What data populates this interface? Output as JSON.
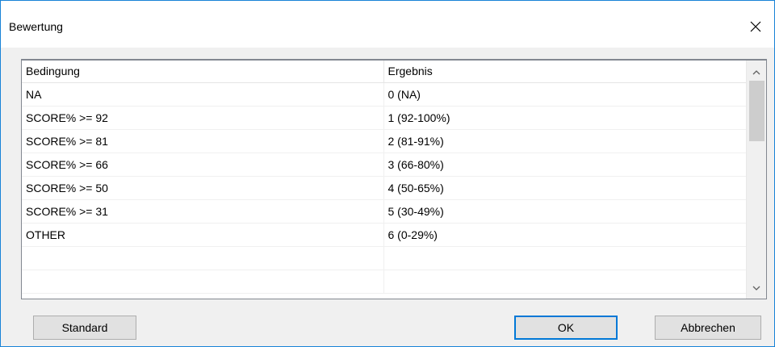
{
  "window": {
    "title": "Bewertung",
    "close_icon": "close-icon"
  },
  "table": {
    "columns": [
      "Bedingung",
      "Ergebnis"
    ],
    "rows": [
      [
        "NA",
        "0 (NA)"
      ],
      [
        "SCORE% >= 92",
        "1 (92-100%)"
      ],
      [
        "SCORE% >= 81",
        "2 (81-91%)"
      ],
      [
        "SCORE% >= 66",
        "3 (66-80%)"
      ],
      [
        "SCORE% >= 50",
        "4 (50-65%)"
      ],
      [
        "SCORE% >= 31",
        "5 (30-49%)"
      ],
      [
        "OTHER",
        "6 (0-29%)"
      ],
      [
        "",
        ""
      ],
      [
        "",
        ""
      ]
    ]
  },
  "buttons": {
    "standard": "Standard",
    "ok": "OK",
    "cancel": "Abbrechen"
  },
  "colors": {
    "accent": "#0078d7",
    "border": "#1883d7"
  }
}
